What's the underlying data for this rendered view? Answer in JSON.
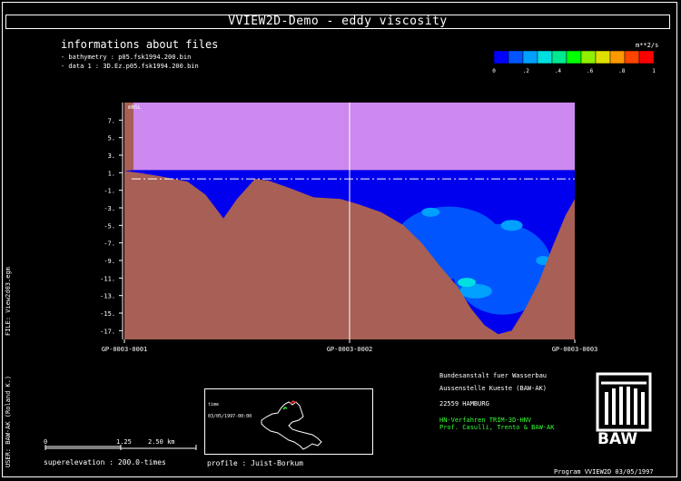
{
  "title": "VVIEW2D-Demo  -  eddy viscosity",
  "info": {
    "heading": "informations about files",
    "line1": "- bathymetry :    p05.fsk1994.200.bin",
    "line2": "- data 1 :      3D.Ez.p05.fsk1994.200.bin"
  },
  "legend": {
    "unit": "m**2/s",
    "colors": [
      "#0000ff",
      "#0055ff",
      "#00a0ff",
      "#00e0e0",
      "#00e890",
      "#00ff00",
      "#90f000",
      "#e0e000",
      "#ff9900",
      "#ff4400",
      "#ff0000"
    ],
    "labels": [
      "0",
      ".2",
      ".4",
      ".6",
      ".8",
      "1"
    ]
  },
  "chart_data": {
    "type": "area",
    "title": "eddy viscosity",
    "ylabel": "mNSL",
    "yticks": [
      "7.",
      "5.",
      "3.",
      "1.",
      "-1.",
      "-3.",
      "-5.",
      "-7.",
      "-9.",
      "-11.",
      "-13.",
      "-15.",
      "-17."
    ],
    "ylim": [
      -18,
      9
    ],
    "xticks": [
      "GP-0003-0001",
      "GP-0003-0002",
      "GP-0003-0003"
    ],
    "x": [
      0,
      0.03,
      0.08,
      0.14,
      0.18,
      0.22,
      0.25,
      0.29,
      0.32,
      0.37,
      0.42,
      0.48,
      0.52,
      0.57,
      0.62,
      0.66,
      0.7,
      0.74,
      0.77,
      0.8,
      0.83,
      0.86,
      0.89,
      0.92,
      0.95,
      0.98,
      1.0
    ],
    "bed_elevation": [
      1.2,
      1.0,
      0.6,
      0.0,
      -1.5,
      -4.2,
      -2.0,
      0.3,
      0.1,
      -0.8,
      -1.8,
      -2.0,
      -2.6,
      -3.5,
      -5.0,
      -7.0,
      -9.6,
      -12.0,
      -14.5,
      -16.4,
      -17.4,
      -17.0,
      -14.5,
      -11.5,
      -7.5,
      -3.8,
      -2.0
    ],
    "water_level": 0.3,
    "color_scale": [
      0,
      1
    ],
    "color_unit": "m**2/s"
  },
  "side_labels": {
    "file": "FILE: View2d03.egm",
    "user": "USER: BAW-AK (Roland K.)"
  },
  "scale": {
    "ticks": [
      "0",
      "1.25",
      "2.50 km"
    ],
    "superelevation": "superelevation :   200.0-times"
  },
  "map": {
    "label1": "time",
    "label2": "03/05/1997-00:00"
  },
  "profile": "profile :   Juist-Borkum",
  "institution": {
    "line1": "Bundesanstalt fuer Wasserbau",
    "line2": "Aussenstelle Kueste (BAW-AK)",
    "line3": "22559 HAMBURG",
    "line4": "HN-Verfahren TRIM-3D-HNV",
    "line5": "Prof. Casulli, Trento & BAW-AK"
  },
  "logo_text": "BAW",
  "footer": "Program  VVIEW2D      03/05/1997"
}
